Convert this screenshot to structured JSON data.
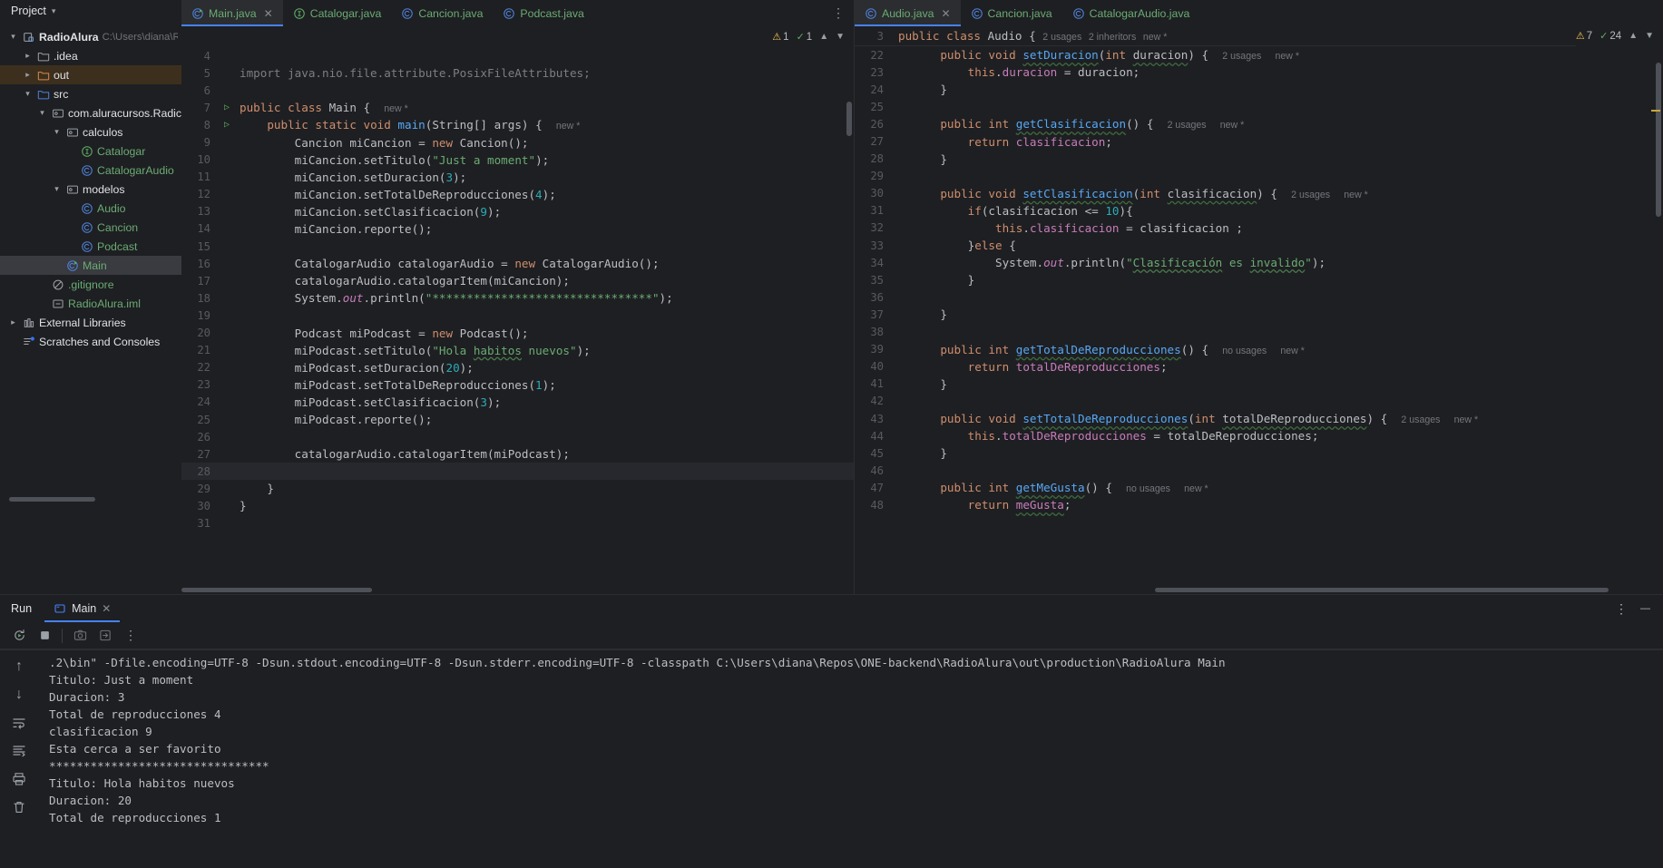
{
  "sidebar": {
    "header": {
      "label": "Project",
      "chevron": "chevron-down-icon"
    },
    "tree": [
      {
        "indent": 0,
        "arrow": "down",
        "icon": "module-icon",
        "label": "RadioAlura",
        "style": "white",
        "suffix": "C:\\Users\\diana\\R",
        "selected": false
      },
      {
        "indent": 1,
        "arrow": "right",
        "icon": "folder-icon",
        "label": ".idea",
        "style": "plain"
      },
      {
        "indent": 1,
        "arrow": "right",
        "icon": "folder-out-icon",
        "label": "out",
        "style": "plain",
        "row": "out"
      },
      {
        "indent": 1,
        "arrow": "down",
        "icon": "folder-src-icon",
        "label": "src",
        "style": "plain"
      },
      {
        "indent": 2,
        "arrow": "down",
        "icon": "package-icon",
        "label": "com.aluracursos.Radic",
        "style": "plain"
      },
      {
        "indent": 3,
        "arrow": "down",
        "icon": "package-icon",
        "label": "calculos",
        "style": "plain"
      },
      {
        "indent": 4,
        "arrow": "none",
        "icon": "interface-icon",
        "label": "Catalogar",
        "style": "green"
      },
      {
        "indent": 4,
        "arrow": "none",
        "icon": "class-icon",
        "label": "CatalogarAudio",
        "style": "green"
      },
      {
        "indent": 3,
        "arrow": "down",
        "icon": "package-icon",
        "label": "modelos",
        "style": "plain"
      },
      {
        "indent": 4,
        "arrow": "none",
        "icon": "class-icon",
        "label": "Audio",
        "style": "green"
      },
      {
        "indent": 4,
        "arrow": "none",
        "icon": "class-icon",
        "label": "Cancion",
        "style": "green"
      },
      {
        "indent": 4,
        "arrow": "none",
        "icon": "class-icon",
        "label": "Podcast",
        "style": "green"
      },
      {
        "indent": 3,
        "arrow": "none",
        "icon": "class-run-icon",
        "label": "Main",
        "style": "green",
        "selected": true
      },
      {
        "indent": 2,
        "arrow": "none",
        "icon": "gitignore-icon",
        "label": ".gitignore",
        "style": "green"
      },
      {
        "indent": 2,
        "arrow": "none",
        "icon": "iml-icon",
        "label": "RadioAlura.iml",
        "style": "green"
      },
      {
        "indent": 0,
        "arrow": "right",
        "icon": "library-icon",
        "label": "External Libraries",
        "style": "plain"
      },
      {
        "indent": 0,
        "arrow": "none",
        "icon": "scratches-icon",
        "label": "Scratches and Consoles",
        "style": "plain"
      }
    ]
  },
  "left_editor": {
    "tabs": [
      {
        "label": "Main.java",
        "icon": "class-run-icon",
        "active": true,
        "closable": true
      },
      {
        "label": "Catalogar.java",
        "icon": "interface-icon",
        "active": false,
        "closable": false
      },
      {
        "label": "Cancion.java",
        "icon": "class-icon",
        "active": false,
        "closable": false
      },
      {
        "label": "Podcast.java",
        "icon": "class-icon",
        "active": false,
        "closable": false
      }
    ],
    "more_actions_icon": "vertical-dots-icon",
    "inspections": {
      "warnings": "1",
      "warning_icon": "warning-triangle-icon",
      "checks": "1",
      "check_icon": "green-check-icon",
      "up_icon": "chevron-up-icon",
      "down_icon": "chevron-down-icon"
    },
    "lines": [
      {
        "no": "4",
        "run": false,
        "html": ""
      },
      {
        "no": "5",
        "run": false,
        "html": "<span class='cmt'>import java.nio.file.attribute.PosixFileAttributes;</span>"
      },
      {
        "no": "6",
        "run": false,
        "html": ""
      },
      {
        "no": "7",
        "run": true,
        "html": "<span class='k'>public class </span><span class='t'>Main {</span>  <span class='hint'>new *</span>"
      },
      {
        "no": "8",
        "run": true,
        "html": "    <span class='k'>public static void </span><span class='m'>main</span><span class='t'>(String[] args) {</span>  <span class='hint'>new *</span>"
      },
      {
        "no": "9",
        "run": false,
        "html": "        <span class='t'>Cancion miCancion = </span><span class='k'>new </span><span class='t'>Cancion();</span>"
      },
      {
        "no": "10",
        "run": false,
        "html": "        <span class='t'>miCancion.setTitulo(</span><span class='s'>\"Just a moment\"</span><span class='t'>);</span>"
      },
      {
        "no": "11",
        "run": false,
        "html": "        <span class='t'>miCancion.setDuracion(</span><span class='n'>3</span><span class='t'>);</span>"
      },
      {
        "no": "12",
        "run": false,
        "html": "        <span class='t'>miCancion.setTotalDeReproducciones(</span><span class='n'>4</span><span class='t'>);</span>"
      },
      {
        "no": "13",
        "run": false,
        "html": "        <span class='t'>miCancion.setClasificacion(</span><span class='n'>9</span><span class='t'>);</span>"
      },
      {
        "no": "14",
        "run": false,
        "html": "        <span class='t'>miCancion.reporte();</span>"
      },
      {
        "no": "15",
        "run": false,
        "html": ""
      },
      {
        "no": "16",
        "run": false,
        "html": "        <span class='t'>CatalogarAudio catalogarAudio = </span><span class='k'>new </span><span class='t'>CatalogarAudio();</span>"
      },
      {
        "no": "17",
        "run": false,
        "html": "        <span class='t'>catalogarAudio.catalogarItem(miCancion);</span>"
      },
      {
        "no": "18",
        "run": false,
        "html": "        <span class='t'>System.</span><span class='f ital'>out</span><span class='t'>.println(</span><span class='s'>\"********************************\"</span><span class='t'>);</span>"
      },
      {
        "no": "19",
        "run": false,
        "html": ""
      },
      {
        "no": "20",
        "run": false,
        "html": "        <span class='t'>Podcast miPodcast = </span><span class='k'>new </span><span class='t'>Podcast();</span>"
      },
      {
        "no": "21",
        "run": false,
        "html": "        <span class='t'>miPodcast.setTitulo(</span><span class='s'>\"Hola </span><span class='s sqs'>habitos</span><span class='s'> nuevos\"</span><span class='t'>);</span>"
      },
      {
        "no": "22",
        "run": false,
        "html": "        <span class='t'>miPodcast.setDuracion(</span><span class='n'>20</span><span class='t'>);</span>"
      },
      {
        "no": "23",
        "run": false,
        "html": "        <span class='t'>miPodcast.setTotalDeReproducciones(</span><span class='n'>1</span><span class='t'>);</span>"
      },
      {
        "no": "24",
        "run": false,
        "html": "        <span class='t'>miPodcast.setClasificacion(</span><span class='n'>3</span><span class='t'>);</span>"
      },
      {
        "no": "25",
        "run": false,
        "html": "        <span class='t'>miPodcast.reporte();</span>"
      },
      {
        "no": "26",
        "run": false,
        "html": ""
      },
      {
        "no": "27",
        "run": false,
        "html": "        <span class='t'>catalogarAudio.catalogarItem(miPodcast);</span>"
      },
      {
        "no": "28",
        "run": false,
        "html": "",
        "current": true
      },
      {
        "no": "29",
        "run": false,
        "html": "    <span class='t'>}</span>"
      },
      {
        "no": "30",
        "run": false,
        "html": "<span class='t'>}</span>"
      },
      {
        "no": "31",
        "run": false,
        "html": ""
      }
    ]
  },
  "right_editor": {
    "tabs": [
      {
        "label": "Audio.java",
        "icon": "class-icon",
        "active": true,
        "closable": true
      },
      {
        "label": "Cancion.java",
        "icon": "class-icon",
        "active": false,
        "closable": false
      },
      {
        "label": "CatalogarAudio.java",
        "icon": "class-icon",
        "active": false,
        "closable": false
      }
    ],
    "inspections": {
      "warnings": "7",
      "warning_icon": "warning-triangle-icon",
      "checks": "24",
      "check_icon": "green-check-icon",
      "up_icon": "chevron-up-icon",
      "down_icon": "chevron-down-icon"
    },
    "sticky_line": {
      "no": "3",
      "html": "<span class='k'>public class </span><span class='t'>Audio {</span>  <span class='hint'>2 usages</span>  <span class='hint'>2 inheritors</span>  <span class='hint'>new *</span>"
    },
    "lines": [
      {
        "no": "22",
        "html": "    <span class='k'>public void </span><span class='m sq'>setDuracion</span><span class='t'>(</span><span class='k'>int </span><span class='t sq'>duracion</span><span class='t'>) {</span>  <span class='hint'>2 usages</span>  <span class='hint'>new *</span>"
      },
      {
        "no": "23",
        "html": "        <span class='k'>this</span><span class='t'>.</span><span class='f'>duracion</span><span class='t'> = duracion;</span>"
      },
      {
        "no": "24",
        "html": "    <span class='t'>}</span>"
      },
      {
        "no": "25",
        "html": ""
      },
      {
        "no": "26",
        "html": "    <span class='k'>public int </span><span class='m sq'>getClasificacion</span><span class='t'>() {</span>  <span class='hint'>2 usages</span>  <span class='hint'>new *</span>"
      },
      {
        "no": "27",
        "html": "        <span class='k'>return </span><span class='f'>clasificacion</span><span class='t'>;</span>"
      },
      {
        "no": "28",
        "html": "    <span class='t'>}</span>"
      },
      {
        "no": "29",
        "html": ""
      },
      {
        "no": "30",
        "html": "    <span class='k'>public void </span><span class='m sq'>setClasificacion</span><span class='t'>(</span><span class='k'>int </span><span class='t sq'>clasificacion</span><span class='t'>) {</span>  <span class='hint'>2 usages</span>  <span class='hint'>new *</span>"
      },
      {
        "no": "31",
        "html": "        <span class='k'>if</span><span class='t'>(clasificacion &lt;= </span><span class='n'>10</span><span class='t'>){</span>"
      },
      {
        "no": "32",
        "html": "            <span class='k'>this</span><span class='t'>.</span><span class='f'>clasificacion</span><span class='t'> = clasificacion ;</span>"
      },
      {
        "no": "33",
        "html": "        <span class='t'>}</span><span class='k'>else </span><span class='t'>{</span>"
      },
      {
        "no": "34",
        "html": "            <span class='t'>System.</span><span class='f ital'>out</span><span class='t'>.println(</span><span class='s'>\"</span><span class='s sqs'>Clasificación</span><span class='s'> es </span><span class='s sqs'>invalido</span><span class='s'>\"</span><span class='t'>);</span>"
      },
      {
        "no": "35",
        "html": "        <span class='t'>}</span>"
      },
      {
        "no": "36",
        "html": ""
      },
      {
        "no": "37",
        "html": "    <span class='t'>}</span>"
      },
      {
        "no": "38",
        "html": ""
      },
      {
        "no": "39",
        "html": "    <span class='k'>public int </span><span class='m sq'>getTotalDeReproducciones</span><span class='t'>() {</span>  <span class='hint'>no usages</span>  <span class='hint'>new *</span>"
      },
      {
        "no": "40",
        "html": "        <span class='k'>return </span><span class='f'>totalDeReproducciones</span><span class='t'>;</span>"
      },
      {
        "no": "41",
        "html": "    <span class='t'>}</span>"
      },
      {
        "no": "42",
        "html": ""
      },
      {
        "no": "43",
        "html": "    <span class='k'>public void </span><span class='m sq'>setTotalDeReproducciones</span><span class='t'>(</span><span class='k'>int </span><span class='t sq'>totalDeReproducciones</span><span class='t'>) {</span>  <span class='hint'>2 usages</span>  <span class='hint'>new *</span>"
      },
      {
        "no": "44",
        "html": "        <span class='k'>this</span><span class='t'>.</span><span class='f'>totalDeReproducciones</span><span class='t'> = totalDeReproducciones;</span>"
      },
      {
        "no": "45",
        "html": "    <span class='t'>}</span>"
      },
      {
        "no": "46",
        "html": ""
      },
      {
        "no": "47",
        "html": "    <span class='k'>public int </span><span class='m sq'>getMeGusta</span><span class='t'>() {</span>  <span class='hint'>no usages</span>  <span class='hint'>new *</span>"
      },
      {
        "no": "48",
        "html": "        <span class='k'>return </span><span class='f sq'>meGusta</span><span class='t'>;</span>"
      }
    ]
  },
  "run_window": {
    "title": "Run",
    "tab": {
      "label": "Main",
      "icon": "console-icon",
      "close_icon": "close-icon"
    },
    "header_actions": [
      {
        "name": "options-icon",
        "glyph": "⋮"
      },
      {
        "name": "minimize-icon",
        "glyph": "—"
      }
    ],
    "toolbar": [
      {
        "name": "rerun-icon"
      },
      {
        "name": "stop-icon"
      },
      {
        "name": "screenshot-icon"
      },
      {
        "name": "dump-threads-icon"
      },
      {
        "name": "more-options-icon"
      }
    ],
    "side_actions": [
      {
        "name": "scroll-up-icon",
        "glyph": "↑"
      },
      {
        "name": "scroll-down-icon",
        "glyph": "↓"
      },
      {
        "name": "soft-wrap-icon"
      },
      {
        "name": "scroll-to-end-icon"
      },
      {
        "name": "print-icon"
      },
      {
        "name": "clear-all-icon"
      }
    ],
    "console_output": [
      ".2\\bin\" -Dfile.encoding=UTF-8 -Dsun.stdout.encoding=UTF-8 -Dsun.stderr.encoding=UTF-8 -classpath C:\\Users\\diana\\Repos\\ONE-backend\\RadioAlura\\out\\production\\RadioAlura Main",
      "Titulo: Just a moment",
      "Duracion: 3",
      "Total de reproducciones 4",
      "clasificacion 9",
      "Esta cerca a ser favorito",
      "********************************",
      "Titulo: Hola habitos nuevos",
      "Duracion: 20",
      "Total de reproducciones 1"
    ]
  },
  "colors": {
    "background": "#1e1f22",
    "panel": "#2b2d30",
    "accent_blue": "#4682fa",
    "selection": "#393b40",
    "green_text": "#6aab73",
    "keyword_orange": "#cf8e6d",
    "number_cyan": "#2aacb8",
    "method_blue": "#56a8f5",
    "field_purple": "#c77dbb",
    "warning_yellow": "#f2c55c",
    "out_folder_highlight": "#3d2f1e"
  }
}
